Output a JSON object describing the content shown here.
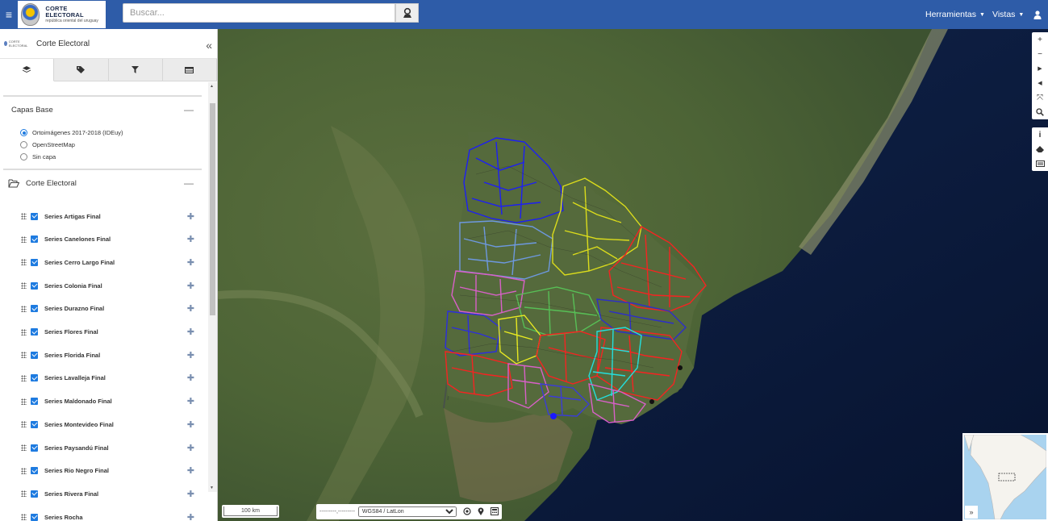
{
  "header": {
    "logo_title": "CORTE ELECTORAL",
    "logo_subtitle": "república oriental del uruguay",
    "search_placeholder": "Buscar...",
    "menu_tools": "Herramientas",
    "menu_views": "Vistas"
  },
  "sidebar": {
    "logo_text": "CORTE ELECTORAL",
    "title": "Corte Electoral",
    "tabs": [
      "layers-icon",
      "tags-icon",
      "filter-icon",
      "table-icon"
    ],
    "base_section": {
      "title": "Capas Base",
      "options": [
        {
          "label": "Ortoimágenes 2017-2018 (IDEuy)",
          "selected": true
        },
        {
          "label": "OpenStreetMap",
          "selected": false
        },
        {
          "label": "Sin capa",
          "selected": false
        }
      ]
    },
    "group": {
      "title": "Corte Electoral",
      "layers": [
        "Series Artigas Final",
        "Series Canelones Final",
        "Series Cerro Largo Final",
        "Series Colonia Final",
        "Series Durazno Final",
        "Series Flores Final",
        "Series Florida Final",
        "Series Lavalleja Final",
        "Series Maldonado Final",
        "Series Montevideo Final",
        "Series Paysandú Final",
        "Series Rio Negro Final",
        "Series Rivera Final",
        "Series Rocha"
      ]
    }
  },
  "map": {
    "scale_label": "100 km",
    "coords_text": "---------,---------",
    "projection": "WGS84 / LatLon",
    "overview_toggle": "»",
    "region_colors": [
      "#1a1aff",
      "#6f9be8",
      "#e3e31a",
      "#ff2020",
      "#e060d0",
      "#58c458",
      "#22e6e6"
    ]
  }
}
